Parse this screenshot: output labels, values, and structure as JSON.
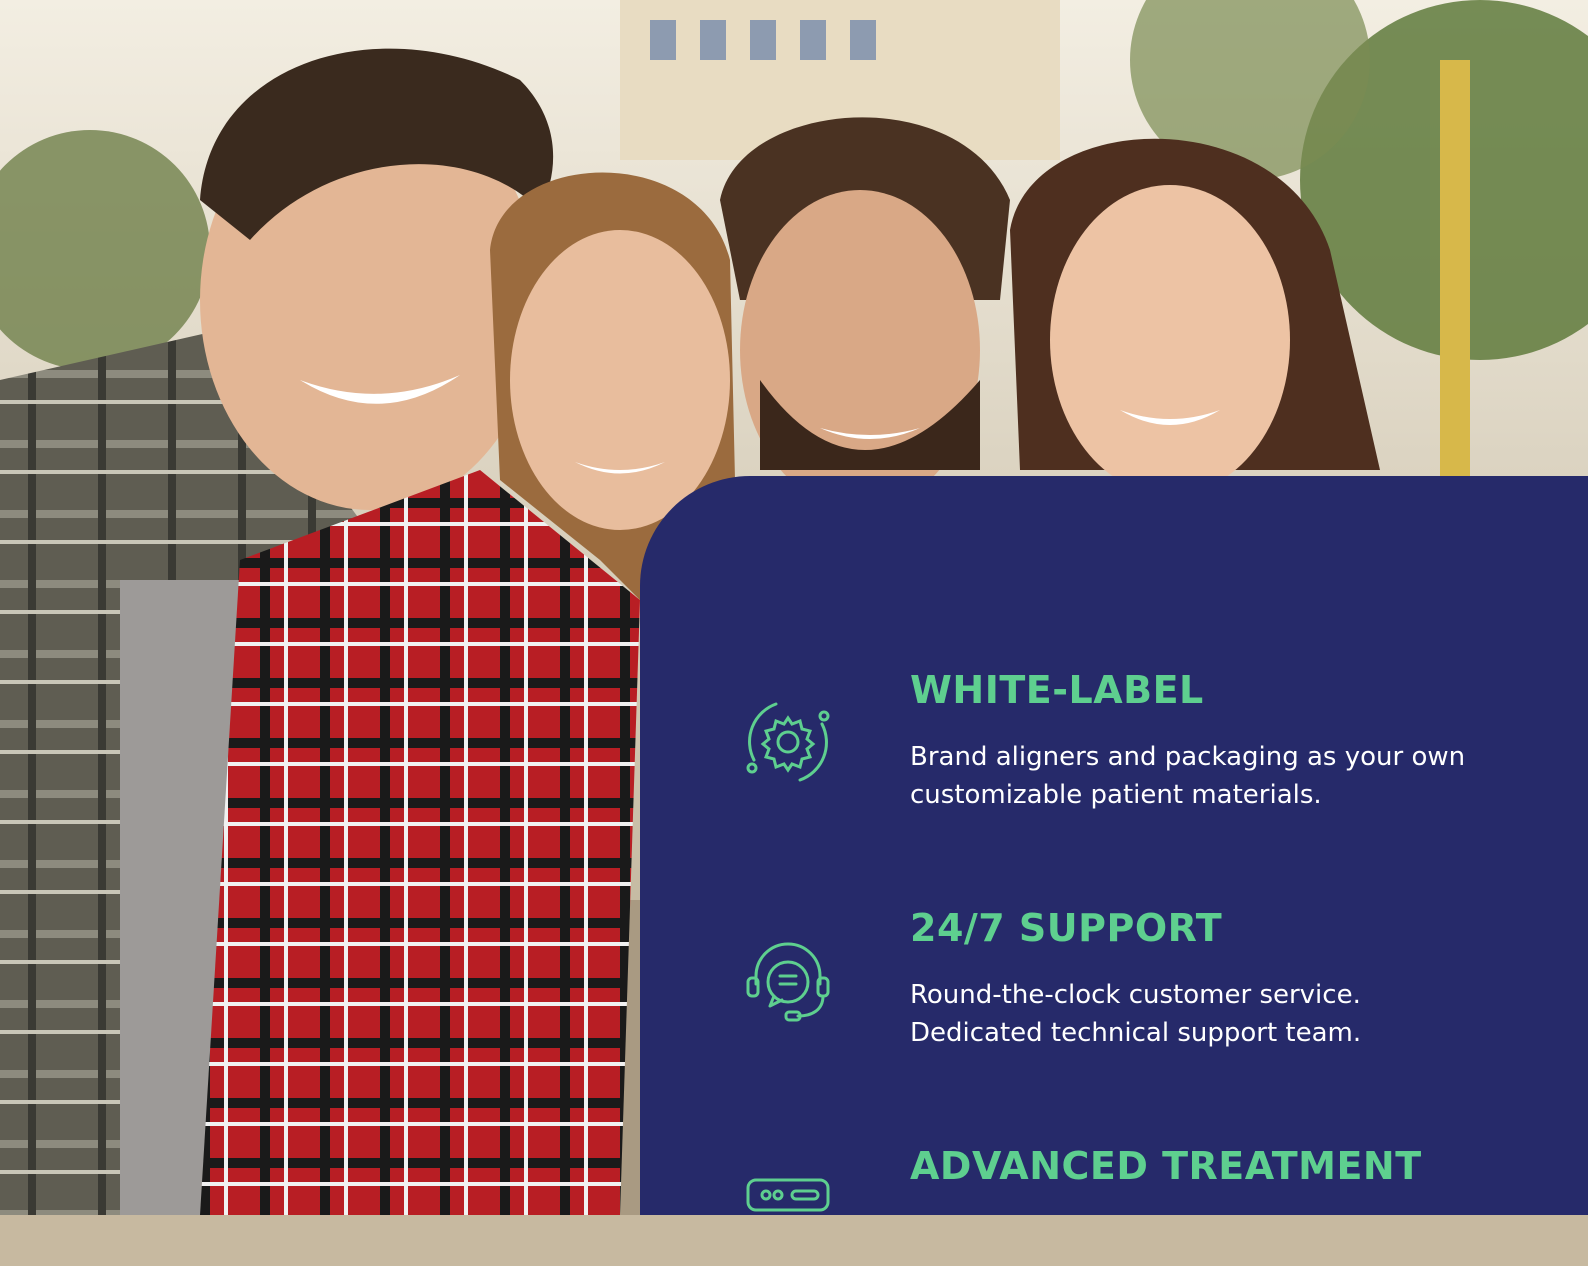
{
  "photo": {
    "icon": "group-smiling-friends-photo"
  },
  "panel": {
    "background": "#262a6a",
    "accent": "#5ecf8f"
  },
  "features": [
    {
      "icon": "gear-orbit-icon",
      "title": "WHITE-LABEL",
      "description": "Brand aligners and packaging as your own customizable patient materials."
    },
    {
      "icon": "headset-chat-icon",
      "title": "24/7 SUPPORT",
      "description": "Round-the-clock customer service. Dedicated technical support team."
    },
    {
      "icon": "server-device-icon",
      "title": "ADVANCED TREATMENT",
      "description": ""
    }
  ]
}
